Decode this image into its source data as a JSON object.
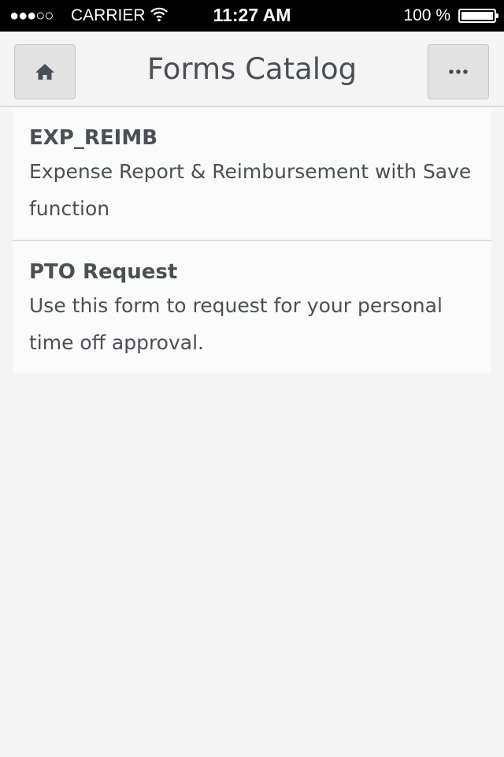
{
  "status_bar": {
    "signal": "●●●○○",
    "carrier": "CARRIER",
    "time": "11:27 AM",
    "battery_text": "100 %",
    "battery_level": 1.0
  },
  "header": {
    "title": "Forms Catalog",
    "home_icon": "home-icon",
    "more_icon": "ellipsis-icon"
  },
  "forms": [
    {
      "name": "EXP_REIMB",
      "description": "Expense Report & Reimbursement with Save function"
    },
    {
      "name": "PTO Request",
      "description": "Use this form to request for your personal time off approval."
    }
  ]
}
